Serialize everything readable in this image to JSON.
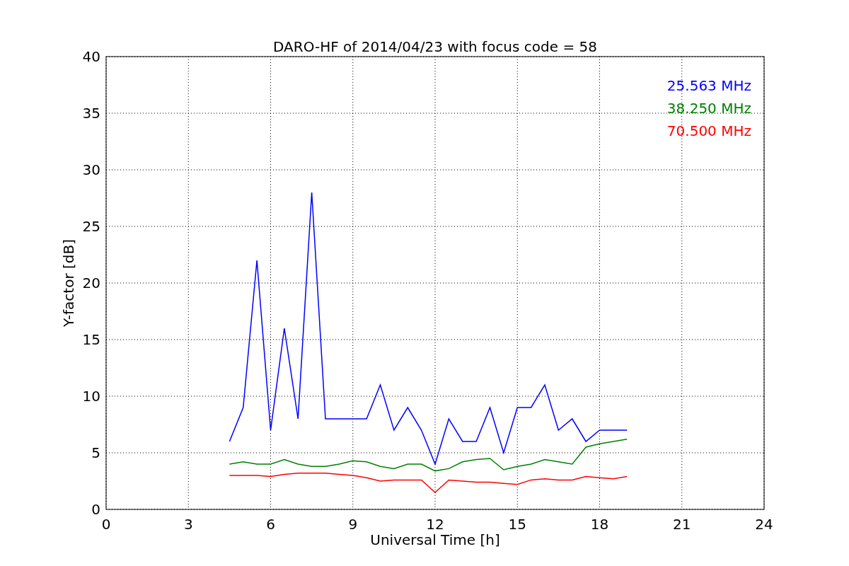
{
  "chart_data": {
    "type": "line",
    "title": "DARO-HF of 2014/04/23 with focus code = 58",
    "xlabel": "Universal Time [h]",
    "ylabel": "Y-factor [dB]",
    "x": [
      4.5,
      5,
      5.5,
      6,
      6.5,
      7,
      7.5,
      8,
      8.5,
      9,
      9.5,
      10,
      10.5,
      11,
      11.5,
      12,
      12.5,
      13,
      13.5,
      14,
      14.5,
      15,
      15.5,
      16,
      16.5,
      17,
      17.5,
      18,
      18.5,
      19
    ],
    "series": [
      {
        "name": "25.563 MHz",
        "color": "#0000ff",
        "values": [
          6,
          9,
          22,
          7,
          16,
          8,
          28,
          8,
          8,
          8,
          8,
          11,
          7,
          9,
          7,
          4,
          8,
          6,
          6,
          9,
          5,
          9,
          9,
          11,
          7,
          8,
          6,
          7,
          7,
          7
        ]
      },
      {
        "name": "38.250 MHz",
        "color": "#008000",
        "values": [
          4,
          4.2,
          4,
          4,
          4.4,
          4,
          3.8,
          3.8,
          4,
          4.3,
          4.2,
          3.8,
          3.6,
          4,
          4,
          3.4,
          3.6,
          4.2,
          4.4,
          4.5,
          3.5,
          3.8,
          4,
          4.4,
          4.2,
          4,
          5.5,
          5.8,
          6,
          6.2
        ]
      },
      {
        "name": "70.500 MHz",
        "color": "#ff0000",
        "values": [
          3,
          3,
          3,
          2.9,
          3.1,
          3.2,
          3.2,
          3.2,
          3.1,
          3,
          2.8,
          2.5,
          2.6,
          2.6,
          2.6,
          1.5,
          2.6,
          2.5,
          2.4,
          2.4,
          2.3,
          2.2,
          2.6,
          2.7,
          2.6,
          2.6,
          2.9,
          2.8,
          2.7,
          2.9
        ]
      }
    ],
    "xlim": [
      0,
      24
    ],
    "ylim": [
      0,
      40
    ],
    "xticks": [
      0,
      3,
      6,
      9,
      12,
      15,
      18,
      21,
      24
    ],
    "yticks": [
      0,
      5,
      10,
      15,
      20,
      25,
      30,
      35,
      40
    ],
    "grid": true
  }
}
